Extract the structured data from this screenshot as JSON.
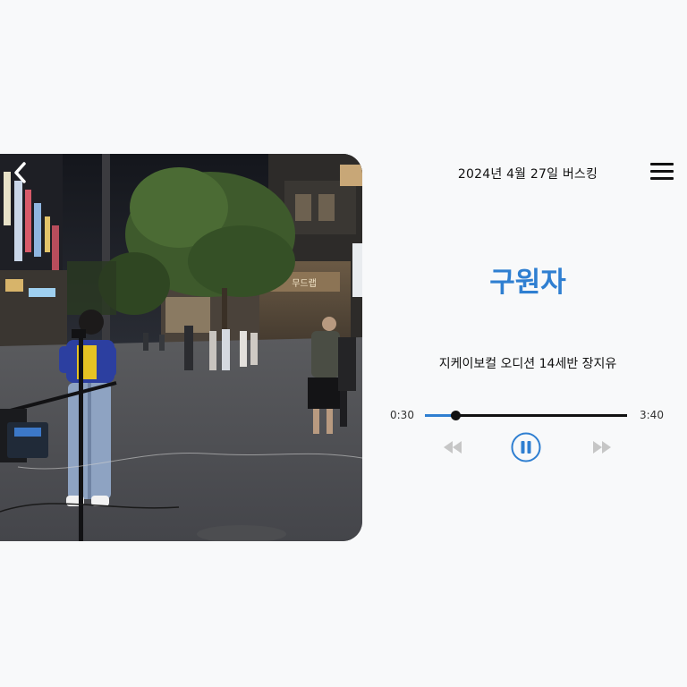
{
  "header": {
    "title": "2024년 4월 27일 버스킹",
    "back_icon": "chevron-left-icon",
    "menu_icon": "hamburger-menu-icon"
  },
  "photo": {
    "shop_sign": "무드랩"
  },
  "track": {
    "title": "구원자",
    "artist": "지케이보컬 오디션 14세반 장지유"
  },
  "player": {
    "current_time": "0:30",
    "total_time": "3:40",
    "progress_fraction": 0.15,
    "state": "playing",
    "controls": [
      "rewind-icon",
      "pause-icon",
      "fast-forward-icon"
    ]
  },
  "colors": {
    "accent": "#2f7fd1",
    "text": "#111111",
    "disabled": "#c6c6c6",
    "background": "#f8f9fa"
  }
}
